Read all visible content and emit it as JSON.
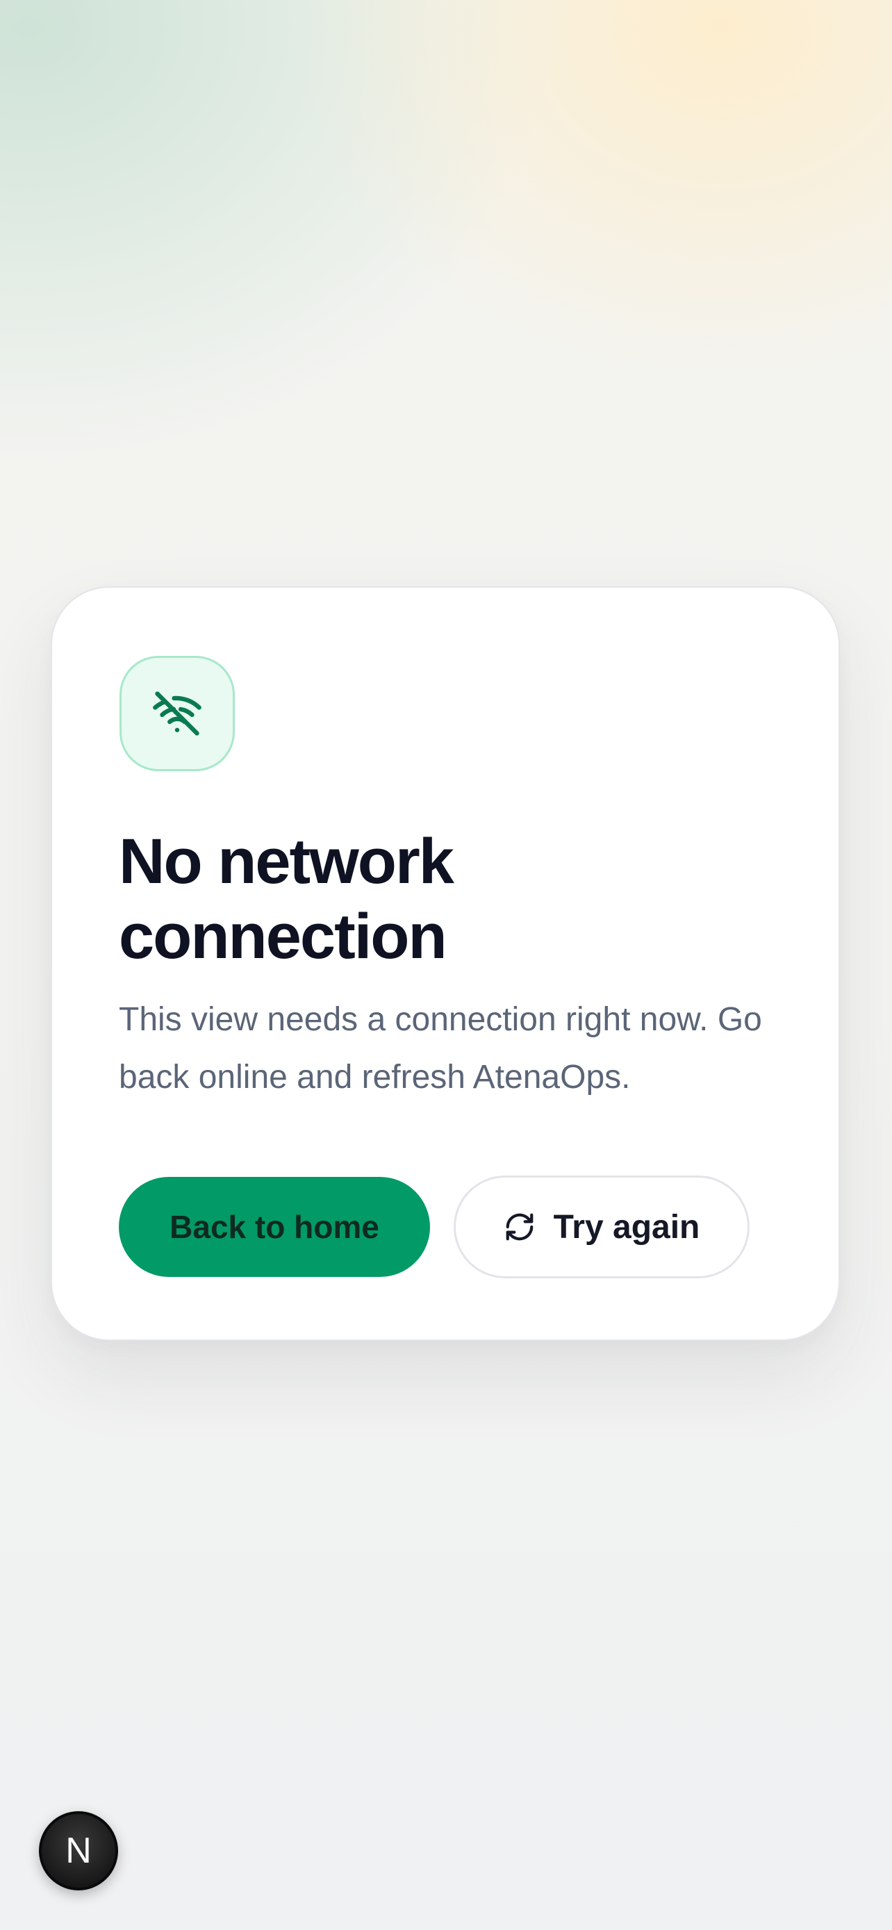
{
  "error_card": {
    "title": "No network connection",
    "message": "This view needs a connection right now. Go back online and refresh AtenaOps.",
    "status_icon": "wifi-off-icon",
    "primary_button_label": "Back to home",
    "secondary_button_label": "Try again",
    "secondary_button_icon": "refresh-icon"
  },
  "fab": {
    "label": "N"
  },
  "colors": {
    "accent": "#029a67",
    "icon_tile_bg": "#e8faf1",
    "icon_stroke": "#0a7a52",
    "title": "#0f1222",
    "body_text": "#5b6578"
  }
}
